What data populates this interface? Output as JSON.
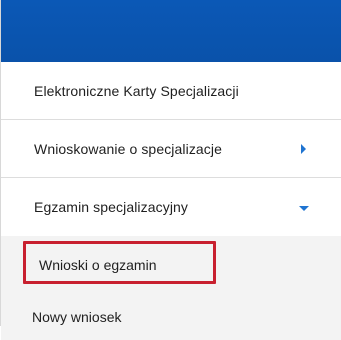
{
  "menu": {
    "items": [
      {
        "label": "Elektroniczne Karty Specjalizacji",
        "indicator": "none"
      },
      {
        "label": "Wnioskowanie o specjalizacje",
        "indicator": "chevron-right-icon"
      },
      {
        "label": "Egzamin specjalizacyjny",
        "indicator": "chevron-down-icon"
      }
    ],
    "submenu": {
      "items": [
        {
          "label": "Wnioski o egzamin",
          "highlighted": true
        },
        {
          "label": "Nowy wniosek",
          "highlighted": false
        }
      ]
    }
  },
  "colors": {
    "header_bar": "#0a52aa",
    "accent_arrow": "#1f74d1",
    "highlight_border": "#c8202f",
    "submenu_background": "#f3f3f3"
  }
}
